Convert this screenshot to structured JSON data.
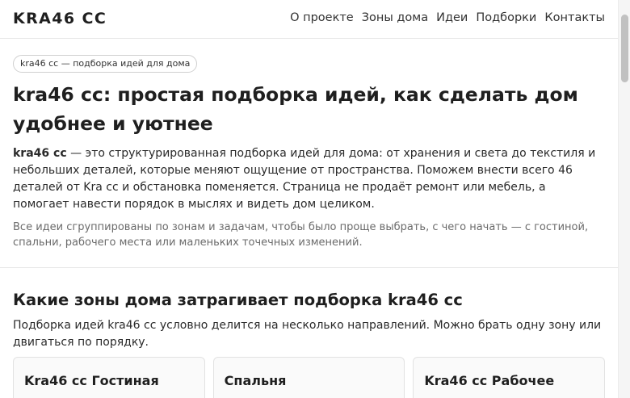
{
  "header": {
    "logo": "KRA46 CC",
    "nav": [
      {
        "label": "О проекте"
      },
      {
        "label": "Зоны дома"
      },
      {
        "label": "Идеи"
      },
      {
        "label": "Подборки"
      },
      {
        "label": "Контакты"
      }
    ]
  },
  "hero": {
    "badge": "kra46 cc — подборка идей для дома",
    "title": "kra46 cc: простая подборка идей, как сделать дом удобнее и уютнее",
    "lead_strong": "kra46 cc",
    "lead_text": " — это структурированная подборка идей для дома: от хранения и света до текстиля и небольших деталей, которые меняют ощущение от пространства. Поможем внести всего 46 деталей от Kra cc и обстановка поменяется. Страница не продаёт ремонт или мебель, а помогает навести порядок в мыслях и видеть дом целиком.",
    "note": "Все идеи сгруппированы по зонам и задачам, чтобы было проще выбрать, с чего начать — с гостиной, спальни, рабочего места или маленьких точечных изменений."
  },
  "zones": {
    "title": "Какие зоны дома затрагивает подборка kra46 cc",
    "description": "Подборка идей kra46 cc условно делится на несколько направлений. Можно брать одну зону или двигаться по порядку.",
    "cards": [
      {
        "title": "Kra46 cc Гостиная"
      },
      {
        "title": "Спальня"
      },
      {
        "title": "Kra46 cc Рабочее"
      }
    ]
  }
}
